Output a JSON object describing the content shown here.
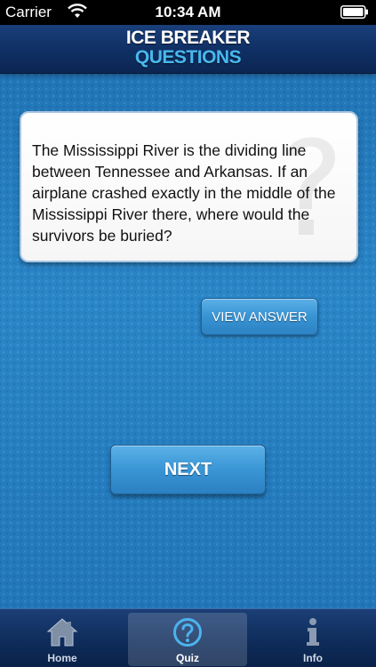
{
  "status_bar": {
    "carrier": "Carrier",
    "time": "10:34 AM"
  },
  "header": {
    "title_line1": "ICE BREAKER",
    "title_line2": "QUESTIONS"
  },
  "question": {
    "text": "The Mississippi River is the dividing line between Tennessee and Arkansas. If an airplane crashed exactly in the middle of the Mississippi River there, where would the survivors be buried?"
  },
  "buttons": {
    "view_answer": "VIEW ANSWER",
    "next": "NEXT"
  },
  "tab_bar": {
    "tabs": [
      {
        "label": "Home",
        "icon": "home-icon",
        "active": false
      },
      {
        "label": "Quiz",
        "icon": "question-circle-icon",
        "active": true
      },
      {
        "label": "Info",
        "icon": "info-icon",
        "active": false
      }
    ]
  },
  "colors": {
    "background_blue": "#1f74b6",
    "header_navy": "#0f2f63",
    "title_accent": "#49b8ee",
    "button_blue": "#3893d3"
  }
}
